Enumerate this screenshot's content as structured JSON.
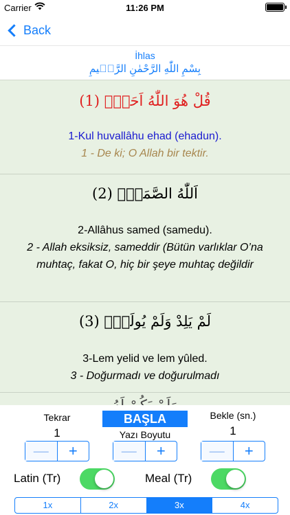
{
  "status": {
    "carrier": "Carrier",
    "time": "11:26 PM"
  },
  "nav": {
    "back_label": "Back"
  },
  "header": {
    "sura_name": "İhlas",
    "basmala": "بِسْمِ اللّٰهِ الرَّحْمٰنِ الرَّح۪يمِ"
  },
  "verses": [
    {
      "arabic": "قُلْ هُوَ اللّٰهُ اَحَدٌۚ (1)",
      "latin": "1-Kul huvallâhu ehad (ehadun).",
      "meal": "1 - De ki; O Allah bir tektir."
    },
    {
      "arabic": "اَللّٰهُ الصَّمَدُۚ (2)",
      "latin": "2-Allâhus samed (samedu).",
      "meal": "2 - Allah eksiksiz, sameddir (Bütün varlıklar O’na muhtaç, fakat O, hiç bir şeye muhtaç değildir"
    },
    {
      "arabic": "لَمْ يَلِدْ وَلَمْ يُولَدْۙ (3)",
      "latin": "3-Lem yelid ve lem yûled.",
      "meal": "3 - Doğurmadı ve doğurulmadı"
    },
    {
      "arabic": "وَلَمْ يَكُنْ لَهُ"
    }
  ],
  "controls": {
    "repeat_label": "Tekrar",
    "repeat_value": "1",
    "start_label": "BAŞLA",
    "font_size_label": "Yazı Boyutu",
    "wait_label": "Bekle (sn.)",
    "wait_value": "1",
    "minus": "—",
    "plus": "+",
    "latin_label": "Latin (Tr)",
    "meal_label": "Meal (Tr)",
    "speeds": [
      "1x",
      "2x",
      "3x",
      "4x"
    ],
    "selected_speed": "3x"
  },
  "colors": {
    "accent": "#147efb",
    "verse_bg": "#e8f1e3",
    "arabic_red": "#e02020",
    "latin_blue": "#1a1ad0",
    "meal_brown": "#a7864e",
    "toggle_on": "#4cd964"
  },
  "icons": {
    "wifi": "wifi-icon",
    "battery": "battery-icon",
    "back": "chevron-left-icon"
  }
}
